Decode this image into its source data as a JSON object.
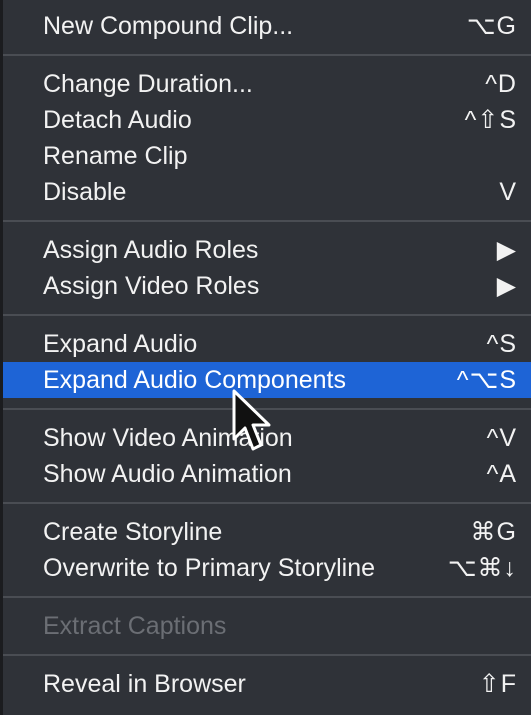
{
  "menu": {
    "groups": [
      {
        "items": [
          {
            "label": "New Compound Clip...",
            "shortcut": "⌥G"
          }
        ]
      },
      {
        "items": [
          {
            "label": "Change Duration...",
            "shortcut": "^D"
          },
          {
            "label": "Detach Audio",
            "shortcut": "^⇧S"
          },
          {
            "label": "Rename Clip",
            "shortcut": ""
          },
          {
            "label": "Disable",
            "shortcut": "V"
          }
        ]
      },
      {
        "items": [
          {
            "label": "Assign Audio Roles",
            "shortcut": "▶"
          },
          {
            "label": "Assign Video Roles",
            "shortcut": "▶"
          }
        ]
      },
      {
        "items": [
          {
            "label": "Expand Audio",
            "shortcut": "^S"
          },
          {
            "label": "Expand Audio Components",
            "shortcut": "^⌥S",
            "state": "highlighted"
          }
        ]
      },
      {
        "items": [
          {
            "label": "Show Video Animation",
            "shortcut": "^V"
          },
          {
            "label": "Show Audio Animation",
            "shortcut": "^A"
          }
        ]
      },
      {
        "items": [
          {
            "label": "Create Storyline",
            "shortcut": "⌘G"
          },
          {
            "label": "Overwrite to Primary Storyline",
            "shortcut": "⌥⌘↓"
          }
        ]
      },
      {
        "items": [
          {
            "label": "Extract Captions",
            "shortcut": "",
            "state": "disabled"
          }
        ]
      },
      {
        "items": [
          {
            "label": "Reveal in Browser",
            "shortcut": "⇧F"
          }
        ]
      }
    ]
  },
  "icons": {
    "cursor": "mouse-pointer-arrow-icon",
    "submenu": "submenu-arrow-icon"
  },
  "colors": {
    "menu_background": "#2f3238",
    "highlight": "#1e64d6",
    "text": "#f2f2f2",
    "disabled_text": "#6b6e74",
    "separator": "#4a4d53"
  }
}
